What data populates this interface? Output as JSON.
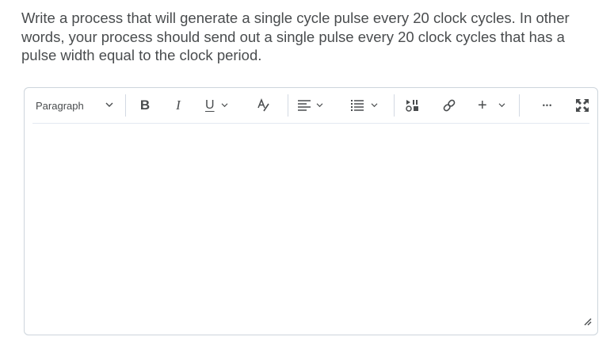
{
  "question": {
    "lines": [
      "Write a process that will generate a single cycle pulse every 20 clock cycles.  In other",
      "words, your process should send out a single pulse every 20 clock cycles that has a",
      "pulse width equal to the clock period."
    ]
  },
  "toolbar": {
    "format_select": "Paragraph",
    "bold_label": "B",
    "italic_label": "I",
    "underline_label": "U",
    "insert_label": "+",
    "more_label": "•••",
    "icons": [
      "chevron-down-icon",
      "text-color-icon",
      "align-icon",
      "bulleted-list-icon",
      "insert-media-icon",
      "link-icon",
      "more-icon",
      "fullscreen-icon",
      "resize-handle-icon"
    ]
  },
  "editor": {
    "value": ""
  },
  "colors": {
    "text": "#494c4e",
    "border": "#cdd5dc",
    "separator": "#d3d9e3"
  }
}
